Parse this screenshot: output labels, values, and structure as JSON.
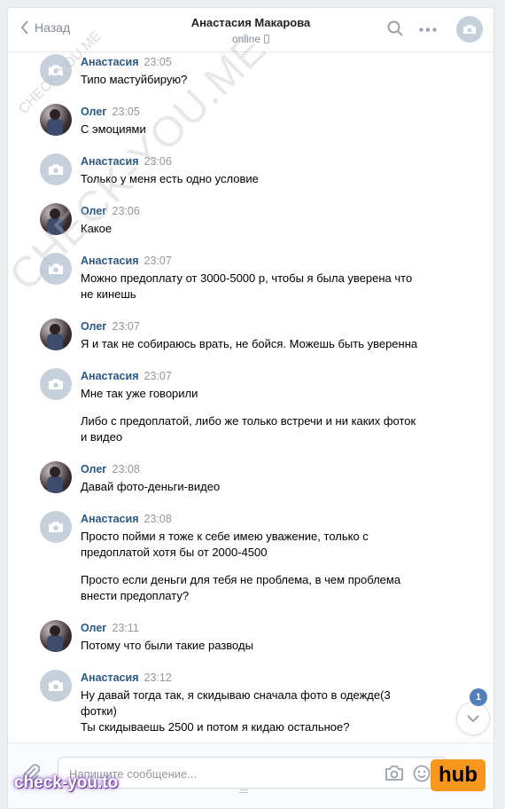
{
  "header": {
    "back_label": "Назад",
    "title": "Анастасия Макарова",
    "status": "online"
  },
  "messages": [
    {
      "author": "Анастасия",
      "time": "23:05",
      "avatar": "camera-placeholder",
      "lines": [
        "Типо мастуйбирую?"
      ]
    },
    {
      "author": "Олег",
      "time": "23:05",
      "avatar": "photo",
      "lines": [
        "С эмоциями"
      ]
    },
    {
      "author": "Анастасия",
      "time": "23:06",
      "avatar": "camera-placeholder",
      "lines": [
        "Только у меня есть одно условие"
      ]
    },
    {
      "author": "Олег",
      "time": "23:06",
      "avatar": "photo",
      "lines": [
        "Какое"
      ]
    },
    {
      "author": "Анастасия",
      "time": "23:07",
      "avatar": "camera-placeholder",
      "lines": [
        "Можно предоплату от 3000-5000 р, чтобы я была уверена что",
        "не кинешь"
      ]
    },
    {
      "author": "Олег",
      "time": "23:07",
      "avatar": "photo",
      "lines": [
        "Я и так не собираюсь врать, не бойся. Можешь быть уверенна"
      ]
    },
    {
      "author": "Анастасия",
      "time": "23:07",
      "avatar": "camera-placeholder",
      "lines": [
        "Мне так уже говорили",
        "",
        "Либо с предоплатой, либо же только встречи и ни каких фоток",
        "и видео"
      ]
    },
    {
      "author": "Олег",
      "time": "23:08",
      "avatar": "photo",
      "lines": [
        "Давай фото-деньги-видео"
      ]
    },
    {
      "author": "Анастасия",
      "time": "23:08",
      "avatar": "camera-placeholder",
      "lines": [
        "Просто пойми я тоже к себе имею уважение, только с",
        "предоплатой хотя бы от 2000-4500",
        "",
        "Просто если деньги для тебя не проблема, в чем проблема",
        "внести предоплату?"
      ]
    },
    {
      "author": "Олег",
      "time": "23:11",
      "avatar": "photo",
      "lines": [
        "Потому что были такие разводы"
      ]
    },
    {
      "author": "Анастасия",
      "time": "23:12",
      "avatar": "camera-placeholder",
      "lines": [
        "Ну давай тогда так, я скидываю сначала фото в одежде(3",
        "фотки)",
        "Ты скидываешь 2500 и потом я кидаю остальное?"
      ]
    }
  ],
  "unread_count": "1",
  "composer": {
    "placeholder": "Напишите сообщение..."
  },
  "watermarks": {
    "diagonal_large": "CHECK-YOU.ME",
    "diagonal_small": "CHECK-YOU.ME",
    "bottom": "check-you.to",
    "hub": "hub"
  },
  "colors": {
    "link": "#2a5885",
    "accent": "#5181b8",
    "hub_orange": "#f7971d"
  }
}
